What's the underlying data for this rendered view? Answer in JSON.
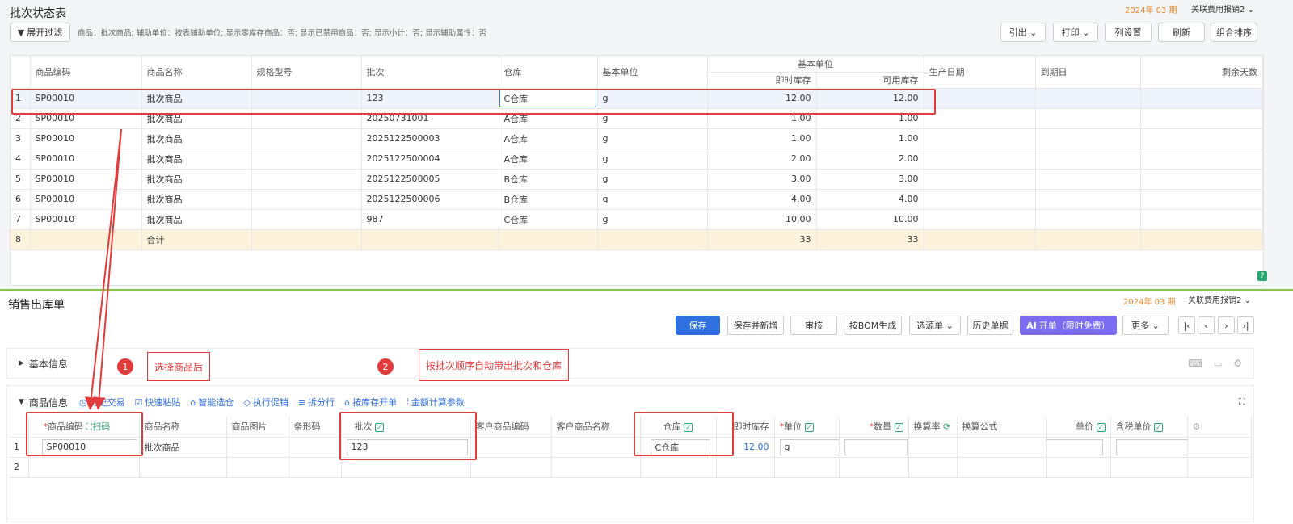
{
  "top": {
    "title": "批次状态表",
    "period": "2024年 03 期",
    "related": "关联费用报销2",
    "filter_btn": "展开过滤",
    "filter_desc": "商品：批次商品; 辅助单位：按表辅助单位; 显示零库存商品：否; 显示已禁用商品：否; 显示小计：否; 显示辅助属性：否",
    "buttons": {
      "export": "引出",
      "print": "打印",
      "colset": "列设置",
      "refresh": "刷新",
      "sort": "组合排序"
    }
  },
  "grid": {
    "headers": [
      "商品编码",
      "商品名称",
      "规格型号",
      "批次",
      "仓库",
      "基本单位"
    ],
    "group": "基本单位",
    "sub": [
      "即时库存",
      "可用库存"
    ],
    "tail": [
      "生产日期",
      "到期日",
      "剩余天数"
    ],
    "rows": [
      [
        "1",
        "SP00010",
        "批次商品",
        "",
        "123",
        "C仓库",
        "g",
        "12.00",
        "12.00"
      ],
      [
        "2",
        "SP00010",
        "批次商品",
        "",
        "20250731001",
        "A仓库",
        "g",
        "1.00",
        "1.00"
      ],
      [
        "3",
        "SP00010",
        "批次商品",
        "",
        "2025122500003",
        "A仓库",
        "g",
        "1.00",
        "1.00"
      ],
      [
        "4",
        "SP00010",
        "批次商品",
        "",
        "2025122500004",
        "A仓库",
        "g",
        "2.00",
        "2.00"
      ],
      [
        "5",
        "SP00010",
        "批次商品",
        "",
        "2025122500005",
        "B仓库",
        "g",
        "3.00",
        "3.00"
      ],
      [
        "6",
        "SP00010",
        "批次商品",
        "",
        "2025122500006",
        "B仓库",
        "g",
        "4.00",
        "4.00"
      ],
      [
        "7",
        "SP00010",
        "批次商品",
        "",
        "987",
        "C仓库",
        "g",
        "10.00",
        "10.00"
      ]
    ],
    "total": {
      "idx": "8",
      "label": "合计",
      "qty": "33",
      "avail": "33"
    }
  },
  "bottom": {
    "title": "销售出库单",
    "period": "2024年 03 期",
    "related": "关联费用报销2",
    "buttons": {
      "save": "保存",
      "save_new": "保存并新增",
      "audit": "审核",
      "bom": "按BOM生成",
      "source": "选源单",
      "history": "历史单据",
      "ai": "开单（限时免费）",
      "more": "更多"
    },
    "basic": "基本信息",
    "goods": "商品信息",
    "tools": [
      "历史交易",
      "快速粘贴",
      "智能选仓",
      "执行促销",
      "拆分行",
      "按库存开单",
      "金额计算参数"
    ],
    "cols": {
      "code": "商品编码",
      "scan": "扫码",
      "name": "商品名称",
      "img": "商品图片",
      "barcode": "条形码",
      "batch": "批次",
      "cust_code": "客户商品编码",
      "cust_name": "客户商品名称",
      "wh": "仓库",
      "stock": "即时库存",
      "unit": "单位",
      "qty": "数量",
      "rate": "换算率",
      "formula": "换算公式",
      "price": "单价",
      "tax_price": "含税单价"
    },
    "row": {
      "idx": "1",
      "code": "SP00010",
      "name": "批次商品",
      "batch": "123",
      "wh": "C仓库",
      "stock": "12.00",
      "unit": "g"
    },
    "row2": "2"
  },
  "callouts": [
    {
      "num": "1",
      "text": "选择商品后"
    },
    {
      "num": "2",
      "text": "按批次顺序自动带出批次和仓库"
    }
  ],
  "colors": {
    "accent": "#2f6fe0",
    "red": "#e23b3b",
    "period": "#e6892b"
  }
}
